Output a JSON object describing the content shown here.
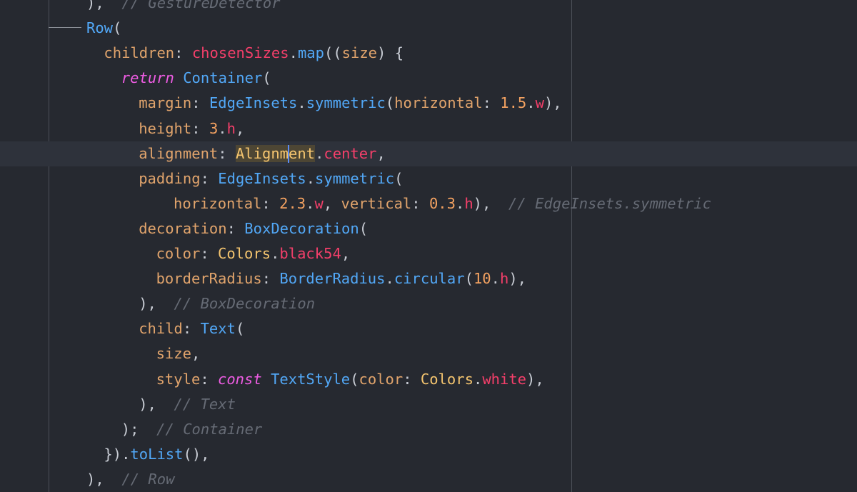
{
  "editor": {
    "language": "dart",
    "cursor": {
      "line": 6,
      "column": 11
    },
    "lines": [
      {
        "indent": 5,
        "tokens": [
          {
            "text": "),",
            "kind": "p"
          },
          {
            "text": "  // GestureDetector",
            "kind": "cm"
          }
        ]
      },
      {
        "indent": 5,
        "tokens": [
          {
            "text": "Row",
            "kind": "c"
          },
          {
            "text": "(",
            "kind": "p"
          }
        ]
      },
      {
        "indent": 6,
        "tokens": [
          {
            "text": "children",
            "kind": "k"
          },
          {
            "text": ": ",
            "kind": "p"
          },
          {
            "text": "chosenSizes",
            "kind": "r"
          },
          {
            "text": ".",
            "kind": "p"
          },
          {
            "text": "map",
            "kind": "c"
          },
          {
            "text": "((",
            "kind": "p"
          },
          {
            "text": "size",
            "kind": "k"
          },
          {
            "text": ") {",
            "kind": "p"
          }
        ]
      },
      {
        "indent": 7,
        "tokens": [
          {
            "text": "return",
            "kind": "kw"
          },
          {
            "text": " ",
            "kind": "p"
          },
          {
            "text": "Container",
            "kind": "c"
          },
          {
            "text": "(",
            "kind": "p"
          }
        ]
      },
      {
        "indent": 8,
        "tokens": [
          {
            "text": "margin",
            "kind": "k"
          },
          {
            "text": ": ",
            "kind": "p"
          },
          {
            "text": "EdgeInsets",
            "kind": "c"
          },
          {
            "text": ".",
            "kind": "p"
          },
          {
            "text": "symmetric",
            "kind": "c"
          },
          {
            "text": "(",
            "kind": "p"
          },
          {
            "text": "horizontal",
            "kind": "k"
          },
          {
            "text": ": ",
            "kind": "p"
          },
          {
            "text": "1.5",
            "kind": "n"
          },
          {
            "text": ".",
            "kind": "p"
          },
          {
            "text": "w",
            "kind": "r"
          },
          {
            "text": "),",
            "kind": "p"
          }
        ]
      },
      {
        "indent": 8,
        "tokens": [
          {
            "text": "height",
            "kind": "k"
          },
          {
            "text": ": ",
            "kind": "p"
          },
          {
            "text": "3",
            "kind": "n"
          },
          {
            "text": ".",
            "kind": "p"
          },
          {
            "text": "h",
            "kind": "r"
          },
          {
            "text": ",",
            "kind": "p"
          }
        ]
      },
      {
        "indent": 8,
        "current": true,
        "tokens": [
          {
            "text": "alignment",
            "kind": "k"
          },
          {
            "text": ": ",
            "kind": "p"
          },
          {
            "text": "Alignment",
            "kind": "y",
            "highlight": true,
            "caret_after": 6
          },
          {
            "text": ".",
            "kind": "p"
          },
          {
            "text": "center",
            "kind": "r"
          },
          {
            "text": ",",
            "kind": "p"
          }
        ]
      },
      {
        "indent": 8,
        "tokens": [
          {
            "text": "padding",
            "kind": "k"
          },
          {
            "text": ": ",
            "kind": "p"
          },
          {
            "text": "EdgeInsets",
            "kind": "c"
          },
          {
            "text": ".",
            "kind": "p"
          },
          {
            "text": "symmetric",
            "kind": "c"
          },
          {
            "text": "(",
            "kind": "p"
          }
        ]
      },
      {
        "indent": 10,
        "tokens": [
          {
            "text": "horizontal",
            "kind": "k"
          },
          {
            "text": ": ",
            "kind": "p"
          },
          {
            "text": "2.3",
            "kind": "n"
          },
          {
            "text": ".",
            "kind": "p"
          },
          {
            "text": "w",
            "kind": "r"
          },
          {
            "text": ", ",
            "kind": "p"
          },
          {
            "text": "vertical",
            "kind": "k"
          },
          {
            "text": ": ",
            "kind": "p"
          },
          {
            "text": "0.3",
            "kind": "n"
          },
          {
            "text": ".",
            "kind": "p"
          },
          {
            "text": "h",
            "kind": "r"
          },
          {
            "text": "),",
            "kind": "p"
          },
          {
            "text": "  // EdgeInsets.symmetric",
            "kind": "cm"
          }
        ]
      },
      {
        "indent": 8,
        "tokens": [
          {
            "text": "decoration",
            "kind": "k"
          },
          {
            "text": ": ",
            "kind": "p"
          },
          {
            "text": "BoxDecoration",
            "kind": "c"
          },
          {
            "text": "(",
            "kind": "p"
          }
        ]
      },
      {
        "indent": 9,
        "tokens": [
          {
            "text": "color",
            "kind": "k"
          },
          {
            "text": ": ",
            "kind": "p"
          },
          {
            "text": "Colors",
            "kind": "y"
          },
          {
            "text": ".",
            "kind": "p"
          },
          {
            "text": "black54",
            "kind": "r"
          },
          {
            "text": ",",
            "kind": "p"
          }
        ]
      },
      {
        "indent": 9,
        "tokens": [
          {
            "text": "borderRadius",
            "kind": "k"
          },
          {
            "text": ": ",
            "kind": "p"
          },
          {
            "text": "BorderRadius",
            "kind": "c"
          },
          {
            "text": ".",
            "kind": "p"
          },
          {
            "text": "circular",
            "kind": "c"
          },
          {
            "text": "(",
            "kind": "p"
          },
          {
            "text": "10",
            "kind": "n"
          },
          {
            "text": ".",
            "kind": "p"
          },
          {
            "text": "h",
            "kind": "r"
          },
          {
            "text": "),",
            "kind": "p"
          }
        ]
      },
      {
        "indent": 8,
        "tokens": [
          {
            "text": "),",
            "kind": "p"
          },
          {
            "text": "  // BoxDecoration",
            "kind": "cm"
          }
        ]
      },
      {
        "indent": 8,
        "tokens": [
          {
            "text": "child",
            "kind": "k"
          },
          {
            "text": ": ",
            "kind": "p"
          },
          {
            "text": "Text",
            "kind": "c"
          },
          {
            "text": "(",
            "kind": "p"
          }
        ]
      },
      {
        "indent": 9,
        "tokens": [
          {
            "text": "size",
            "kind": "k"
          },
          {
            "text": ",",
            "kind": "p"
          }
        ]
      },
      {
        "indent": 9,
        "tokens": [
          {
            "text": "style",
            "kind": "k"
          },
          {
            "text": ": ",
            "kind": "p"
          },
          {
            "text": "const",
            "kind": "kw"
          },
          {
            "text": " ",
            "kind": "p"
          },
          {
            "text": "TextStyle",
            "kind": "c"
          },
          {
            "text": "(",
            "kind": "p"
          },
          {
            "text": "color",
            "kind": "k"
          },
          {
            "text": ": ",
            "kind": "p"
          },
          {
            "text": "Colors",
            "kind": "y"
          },
          {
            "text": ".",
            "kind": "p"
          },
          {
            "text": "white",
            "kind": "r"
          },
          {
            "text": "),",
            "kind": "p"
          }
        ]
      },
      {
        "indent": 8,
        "tokens": [
          {
            "text": "),",
            "kind": "p"
          },
          {
            "text": "  // Text",
            "kind": "cm"
          }
        ]
      },
      {
        "indent": 7,
        "tokens": [
          {
            "text": ");",
            "kind": "p"
          },
          {
            "text": "  // Container",
            "kind": "cm"
          }
        ]
      },
      {
        "indent": 6,
        "tokens": [
          {
            "text": "}).",
            "kind": "p"
          },
          {
            "text": "toList",
            "kind": "c"
          },
          {
            "text": "(),",
            "kind": "p"
          }
        ]
      },
      {
        "indent": 5,
        "tokens": [
          {
            "text": "),",
            "kind": "p"
          },
          {
            "text": "  // Row",
            "kind": "cm"
          }
        ]
      }
    ]
  }
}
